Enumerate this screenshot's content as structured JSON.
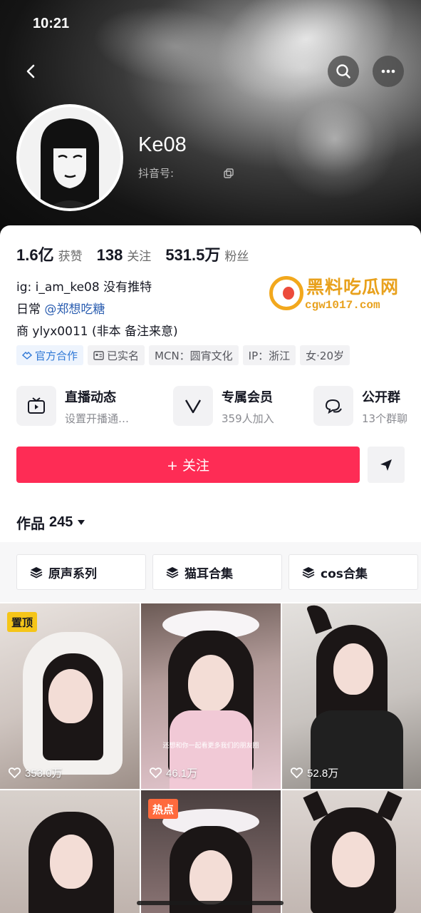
{
  "status_bar": {
    "time": "10:21"
  },
  "profile": {
    "name": "Ke08",
    "douyin_id_label": "抖音号:",
    "likes": "1.6亿",
    "likes_label": "获赞",
    "following": "138",
    "following_label": "关注",
    "followers": "531.5万",
    "followers_label": "粉丝",
    "bio": {
      "line1": "ig: i_am_ke08  没有推特",
      "line2_prefix": "日常 ",
      "line2_mention": "@郑想吃糖",
      "line3": "商 ylyx0011 (非本 备注来意)"
    },
    "tags": [
      {
        "label": "官方合作",
        "icon": "cooperation-icon"
      },
      {
        "label": "已实名",
        "icon": "id-card-icon"
      },
      {
        "label": "MCN：圆宵文化"
      },
      {
        "label": "IP：浙江"
      },
      {
        "label": "女·20岁"
      }
    ]
  },
  "watermark": {
    "title": "黑料吃瓜网",
    "url": "cgw1017.com"
  },
  "features": [
    {
      "title": "直播动态",
      "subtitle": "设置开播通…",
      "icon": "tv-icon"
    },
    {
      "title": "专属会员",
      "subtitle": "359人加入",
      "icon": "v-member-icon"
    },
    {
      "title": "公开群",
      "subtitle": "13个群聊",
      "icon": "chat-bubble-icon"
    }
  ],
  "actions": {
    "follow_label": "+ 关注",
    "share_icon": "send-icon"
  },
  "works": {
    "label": "作品",
    "count": "245"
  },
  "collections": [
    {
      "label": "原声系列",
      "icon": "layers-icon"
    },
    {
      "label": "猫耳合集",
      "icon": "layers-icon"
    },
    {
      "label": "cos合集",
      "icon": "layers-icon"
    }
  ],
  "videos": [
    {
      "likes": "353.0万",
      "badge": "置顶"
    },
    {
      "likes": "46.1万",
      "caption": "还想和你一起看更多我们的朋友圈"
    },
    {
      "likes": "52.8万"
    },
    {
      "likes": ""
    },
    {
      "likes": "",
      "badge": "热点"
    },
    {
      "likes": ""
    }
  ],
  "colors": {
    "accent": "#fe2c55",
    "mention": "#2a5db0",
    "pinned_badge": "#f5c518",
    "hot_badge": "#ff6a3d"
  }
}
